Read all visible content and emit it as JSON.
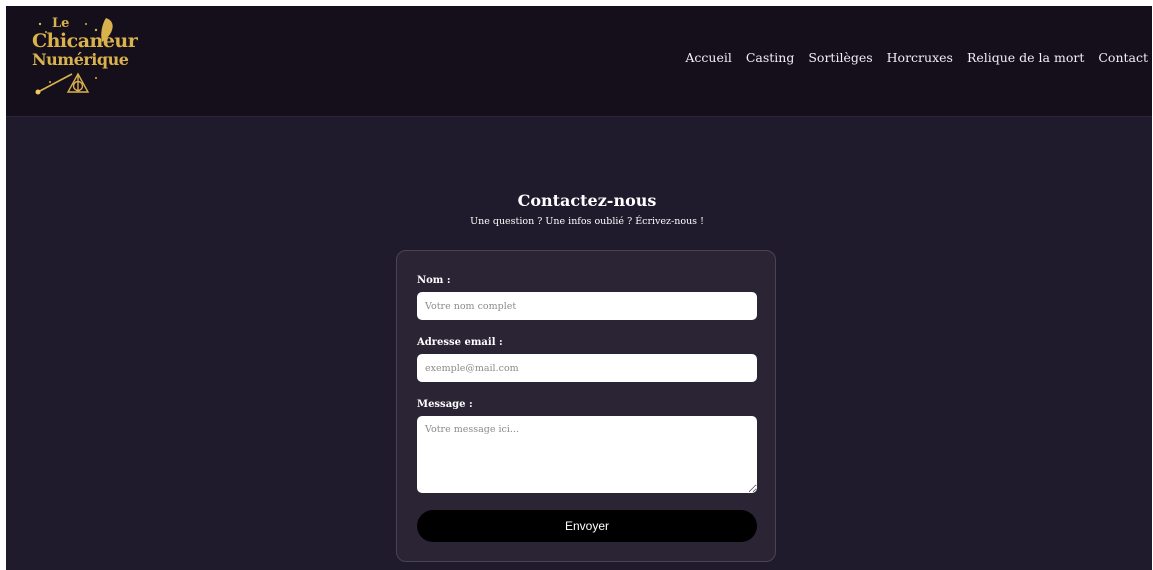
{
  "logo": {
    "line1": "Le",
    "line2": "Chicaneur",
    "line3": "Numérique"
  },
  "nav": {
    "items": [
      {
        "label": "Accueil"
      },
      {
        "label": "Casting"
      },
      {
        "label": "Sortilèges"
      },
      {
        "label": "Horcruxes"
      },
      {
        "label": "Relique de la mort"
      },
      {
        "label": "Contact"
      }
    ]
  },
  "contact": {
    "title": "Contactez-nous",
    "subtitle": "Une question ? Une infos oublié ? Écrivez-nous !",
    "name_label": "Nom :",
    "name_placeholder": "Votre nom complet",
    "email_label": "Adresse email :",
    "email_placeholder": "exemple@mail.com",
    "message_label": "Message :",
    "message_placeholder": "Votre message ici...",
    "submit_label": "Envoyer"
  },
  "colors": {
    "page_bg": "#1f1a2c",
    "header_bg": "#140f1b",
    "card_bg": "#2a2434",
    "logo_gold": "#d9b24d",
    "button_bg": "#000000"
  },
  "icons": [
    "quill-icon",
    "wand-icon",
    "deathly-hallows-icon"
  ]
}
